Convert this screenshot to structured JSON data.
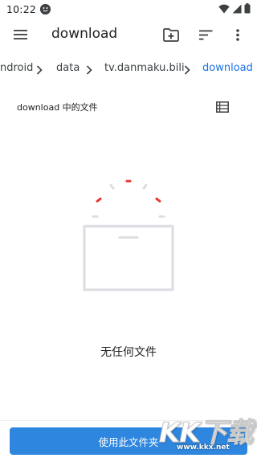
{
  "status_bar": {
    "time": "10:22",
    "icons": [
      "notification-face-icon",
      "wifi-icon",
      "signal-icon",
      "battery-icon"
    ]
  },
  "app_bar": {
    "title": "download",
    "icons": [
      "menu-icon",
      "new-folder-icon",
      "sort-icon",
      "more-vert-icon"
    ]
  },
  "breadcrumb": {
    "items": [
      "ndroid",
      "data",
      "tv.danmaku.bili",
      "download"
    ],
    "active_index": 3,
    "separator_icon": "chevron-right-icon"
  },
  "section": {
    "title": "download 中的文件",
    "view_toggle_icon": "list-view-icon"
  },
  "empty_state": {
    "message": "无任何文件",
    "illustration_icon": "empty-folder-icon"
  },
  "bottom": {
    "use_folder_label": "使用此文件夹"
  },
  "watermark": {
    "logo_text": "KK下载",
    "url": "www.kkx.net"
  },
  "colors": {
    "accent": "#1a73e8",
    "button": "#2e86de",
    "illustration_gray": "#dadce0",
    "illustration_red": "#e53935"
  }
}
